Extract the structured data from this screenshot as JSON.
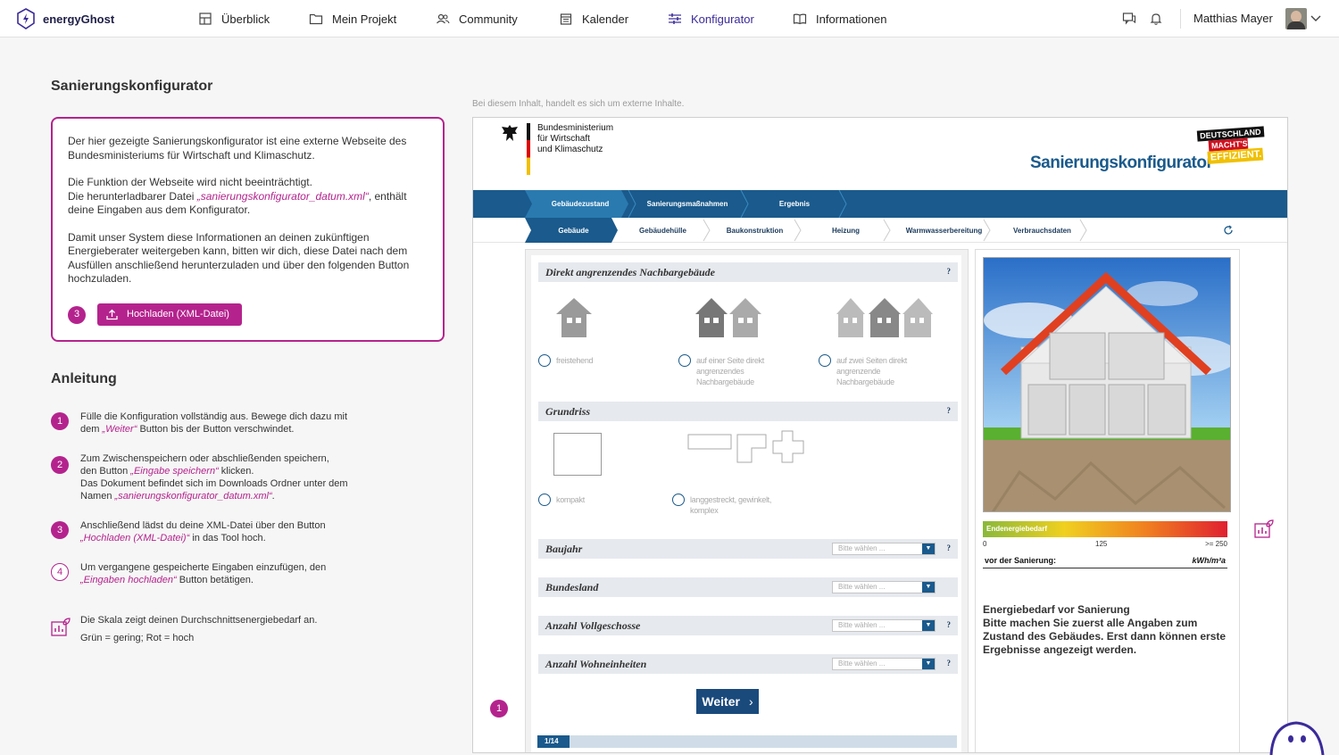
{
  "app": {
    "name": "energyGhost"
  },
  "nav": [
    {
      "label": "Überblick",
      "icon": "overview-icon"
    },
    {
      "label": "Mein Projekt",
      "icon": "folder-icon"
    },
    {
      "label": "Community",
      "icon": "community-icon"
    },
    {
      "label": "Kalender",
      "icon": "calendar-icon"
    },
    {
      "label": "Konfigurator",
      "icon": "sliders-icon",
      "active": true
    },
    {
      "label": "Informationen",
      "icon": "book-icon"
    }
  ],
  "user": {
    "name": "Matthias Mayer"
  },
  "page": {
    "title": "Sanierungskonfigurator"
  },
  "info": {
    "p1": "Der hier gezeigte Sanierungskonfigurator ist eine externe Webseite des Bundesministeriums für Wirtschaft und Klimaschutz.",
    "p2a": "Die Funktion der Webseite wird nicht beeinträchtigt.",
    "p2b_pre": "Die herunterladbarer Datei ",
    "p2b_file": "„sanierungskonfigurator_datum.xml“",
    "p2b_post": ", enthält deine Eingaben aus dem Konfigurator.",
    "p3": "Damit unser System diese Informationen an deinen zukünftigen Energieberater weitergeben kann, bitten wir dich, diese Datei nach dem Ausfüllen anschließend herunterzuladen und über den folgenden Button hochzuladen.",
    "step": "3",
    "upload_label": "Hochladen (XML-Datei)"
  },
  "anleitung": {
    "title": "Anleitung",
    "steps": [
      {
        "num": "1",
        "pre": "Fülle die Konfiguration vollständig aus. Bewege dich dazu mit dem ",
        "hl": "„Weiter“",
        "post": " Button bis der Button verschwindet."
      },
      {
        "num": "2",
        "pre": "Zum Zwischenspeichern oder abschließenden speichern, den Button ",
        "hl": "„Eingabe speichern“",
        "post": " klicken.",
        "line2": "Das Dokument befindet sich im Downloads Ordner unter dem Namen ",
        "hl2": "„sanierungskonfigurator_datum.xml“",
        "post2": "."
      },
      {
        "num": "3",
        "pre": "Anschließend lädst du deine XML-Datei über den Button ",
        "hl": "„Hochladen (XML-Datei)“",
        "post": " in das Tool hoch."
      },
      {
        "num": "4",
        "pre": "Um vergangene gespeicherte Eingaben einzufügen, den ",
        "hl": "„Eingaben hochladen“",
        "post": " Button betätigen."
      }
    ],
    "scale_note1": "Die Skala zeigt deinen Durchschnittsenergiebedarf an.",
    "scale_note2": "Grün = gering; Rot = hoch"
  },
  "external_note": "Bei diesem Inhalt, handelt es sich um externe Inhalte.",
  "embed": {
    "ministry": [
      "Bundesministerium",
      "für Wirtschaft",
      "und Klimaschutz"
    ],
    "title": "Sanierungskonfigurator",
    "badge": [
      "DEUTSCHLAND",
      "MACHT'S",
      "EFFIZIENT."
    ],
    "tabs1": [
      "Gebäudezustand",
      "Sanierungsmaßnahmen",
      "Ergebnis"
    ],
    "tabs2": [
      "Gebäude",
      "Gebäudehülle",
      "Baukonstruktion",
      "Heizung",
      "Warmwasserbereitung",
      "Verbrauchsdaten"
    ],
    "sections": {
      "nachbar": "Direkt angrenzendes Nachbargebäude",
      "grundriss": "Grundriss",
      "baujahr": "Baujahr",
      "bundesland": "Bundesland",
      "vollgeschosse": "Anzahl Vollgeschosse",
      "wohneinheiten": "Anzahl Wohneinheiten",
      "q": "?"
    },
    "options": {
      "freistehend": "freistehend",
      "eine_seite": "auf einer Seite direkt angrenzendes Nachbargebäude",
      "zwei_seiten": "auf zwei Seiten direkt angrenzende Nachbargebäude",
      "kompakt": "kompakt",
      "langgestreckt": "langgestreckt, gewinkelt, komplex"
    },
    "select_placeholder": "Bitte wählen ...",
    "weiter": "Weiter",
    "progress": "1/14",
    "step_badge": "1",
    "energy": {
      "scale_label": "Endenergiebedarf",
      "ticks": [
        "0",
        "125",
        ">= 250"
      ],
      "before_label": "vor der Sanierung:",
      "unit": "kWh/m²a",
      "heading": "Energiebedarf vor Sanierung",
      "text": "Bitte machen Sie zuerst alle Angaben zum Zustand des Gebäudes. Erst dann können erste Ergebnisse angezeigt werden."
    }
  },
  "colors": {
    "accent": "#b4238d",
    "nav_active": "#3b2b9a",
    "embed_blue": "#1a5a8c"
  }
}
